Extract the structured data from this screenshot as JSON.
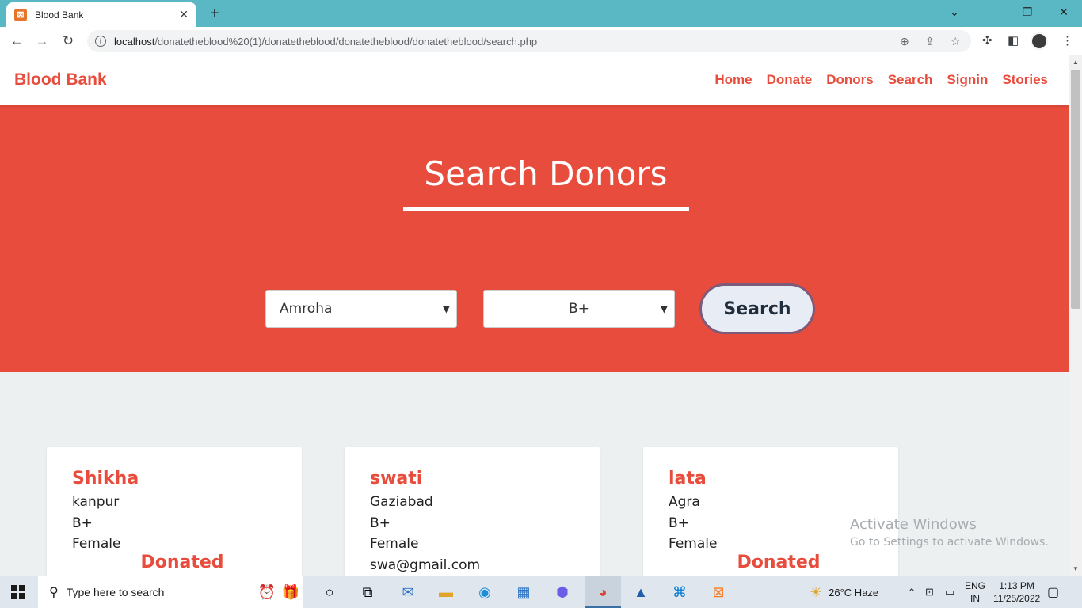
{
  "browser": {
    "tab_title": "Blood Bank",
    "url_host": "localhost",
    "url_path": "/donatetheblood%20(1)/donatetheblood/donatetheblood/donatetheblood/search.php"
  },
  "site": {
    "brand": "Blood Bank",
    "nav": [
      "Home",
      "Donate",
      "Donors",
      "Search",
      "Signin",
      "Stories"
    ]
  },
  "hero": {
    "title": "Search Donors",
    "city_selected": "Amroha",
    "blood_group_selected": "B+",
    "search_label": "Search"
  },
  "donors": [
    {
      "name": "Shikha",
      "city": "kanpur",
      "blood_group": "B+",
      "gender": "Female",
      "email": "",
      "status": "Donated"
    },
    {
      "name": "swati",
      "city": "Gaziabad",
      "blood_group": "B+",
      "gender": "Female",
      "email": "swa@gmail.com",
      "status": ""
    },
    {
      "name": "lata",
      "city": "Agra",
      "blood_group": "B+",
      "gender": "Female",
      "email": "",
      "status": "Donated"
    }
  ],
  "watermark": {
    "line1": "Activate Windows",
    "line2": "Go to Settings to activate Windows."
  },
  "taskbar": {
    "search_placeholder": "Type here to search",
    "weather": "26°C  Haze",
    "lang_top": "ENG",
    "lang_bottom": "IN",
    "time": "1:13 PM",
    "date": "11/25/2022"
  },
  "colors": {
    "brand_red": "#e74c3c",
    "tab_bar": "#5ab8c4"
  }
}
